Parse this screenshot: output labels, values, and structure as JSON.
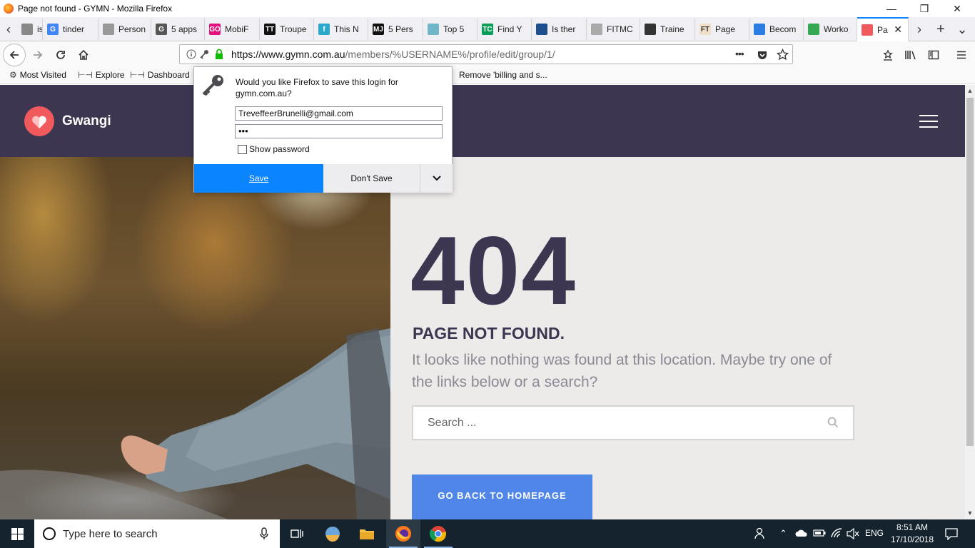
{
  "window": {
    "title": "Page not found - GYMN - Mozilla Firefox",
    "minimize": "—",
    "restore": "❐",
    "close": "✕"
  },
  "tabs": [
    {
      "label": "issp",
      "icon": "",
      "color": "#888888"
    },
    {
      "label": "tinder",
      "icon": "G",
      "color": "#4285f4"
    },
    {
      "label": "Person",
      "icon": "",
      "color": "#999999"
    },
    {
      "label": "5 apps",
      "icon": "G",
      "color": "#555555"
    },
    {
      "label": "MobiF",
      "icon": "GO",
      "color": "#e2137f"
    },
    {
      "label": "Troupe",
      "icon": "TT",
      "color": "#111111"
    },
    {
      "label": "This N",
      "icon": "f",
      "color": "#2ba7c9"
    },
    {
      "label": "5 Pers",
      "icon": "MJ",
      "color": "#111111"
    },
    {
      "label": "Top 5",
      "icon": "",
      "color": "#6fb6c8"
    },
    {
      "label": "Find Y",
      "icon": "TC",
      "color": "#0a9e57"
    },
    {
      "label": "Is ther",
      "icon": "",
      "color": "#1c4f8c"
    },
    {
      "label": "FITMC",
      "icon": "",
      "color": "#aaaaaa"
    },
    {
      "label": "Traine",
      "icon": "",
      "color": "#333333"
    },
    {
      "label": "Page",
      "icon": "FT",
      "color": "#f2dfc9"
    },
    {
      "label": "Becom",
      "icon": "",
      "color": "#2a7de1"
    },
    {
      "label": "Worko",
      "icon": "",
      "color": "#34a853"
    },
    {
      "label": "Pa",
      "icon": "",
      "color": "#f05a5c"
    }
  ],
  "tab_controls": {
    "scroll_left": "‹",
    "scroll_right": "›",
    "new_tab": "+",
    "list": "⌄",
    "close_active": "✕"
  },
  "nav": {
    "url_host": "https://www.gymn.com.au",
    "url_path": "/members/%USERNAME%/profile/edit/group/1/",
    "page_actions": "•••"
  },
  "bookmarks": [
    {
      "label": "Most Visited",
      "icon": "gear-icon"
    },
    {
      "label": "Explore",
      "icon": "bookmark-icon"
    },
    {
      "label": "Dashboard",
      "icon": "bookmark-icon"
    },
    {
      "label": "Remove 'billing and s...",
      "icon": "bookmark-icon"
    }
  ],
  "login_popup": {
    "question": "Would you like Firefox to save this login for gymn.com.au?",
    "username": "TreveffeerBrunelli@gmail.com",
    "password": "•••",
    "show_password": "Show password",
    "save": "Save",
    "dont_save": "Don't Save"
  },
  "site": {
    "brand": "Gwangi",
    "code": "404",
    "heading": "PAGE NOT FOUND.",
    "message": "It looks like nothing was found at this location. Maybe try one of the links below or a search?",
    "search_placeholder": "Search ...",
    "home_button": "GO BACK TO HOMEPAGE",
    "colors": {
      "header": "#3d3650",
      "accent": "#f05a5c",
      "button": "#4f86e7",
      "page_bg": "#edeaea"
    }
  },
  "taskbar": {
    "search_placeholder": "Type here to search",
    "language": "ENG",
    "time": "8:51 AM",
    "date": "17/10/2018"
  }
}
